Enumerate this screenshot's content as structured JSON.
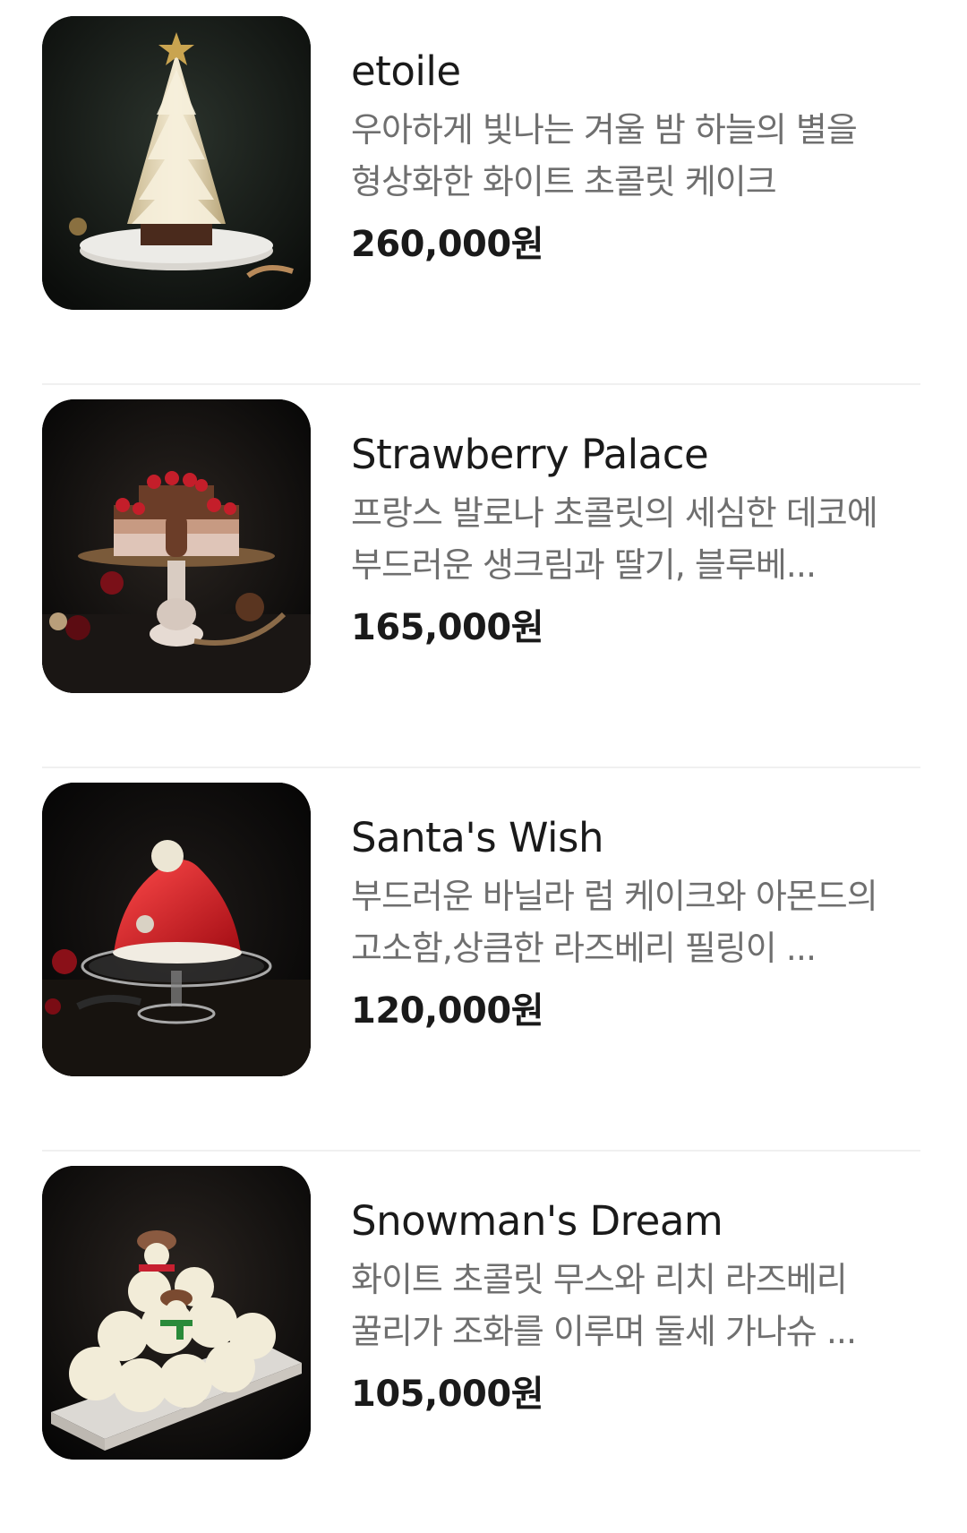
{
  "products": [
    {
      "name": "etoile",
      "description": "우아하게 빛나는 겨울 밤 하늘의 별을 형상화한 화이트 초콜릿 케이크",
      "price": "260,000원",
      "image_icon": "white-chocolate-tree-cake-image"
    },
    {
      "name": "Strawberry Palace",
      "description": "프랑스 발로나 초콜릿의 세심한 데코에 부드러운 생크림과 딸기, 블루베...",
      "price": "165,000원",
      "image_icon": "strawberry-chocolate-cake-image"
    },
    {
      "name": "Santa's Wish",
      "description": "부드러운 바닐라 럼 케이크와 아몬드의 고소함,상큼한 라즈베리 필링이 ...",
      "price": "120,000원",
      "image_icon": "santa-hat-cake-image"
    },
    {
      "name": "Snowman's Dream",
      "description": "화이트 초콜릿 무스와 리치 라즈베리 꿀리가 조화를 이루며 둘세 가나슈 ...",
      "price": "105,000원",
      "image_icon": "snowman-cake-image"
    }
  ],
  "colors": {
    "name": "#1a1a1a",
    "description": "#6f6f6f",
    "price": "#1a1a1a",
    "divider": "#f0f0f0"
  }
}
